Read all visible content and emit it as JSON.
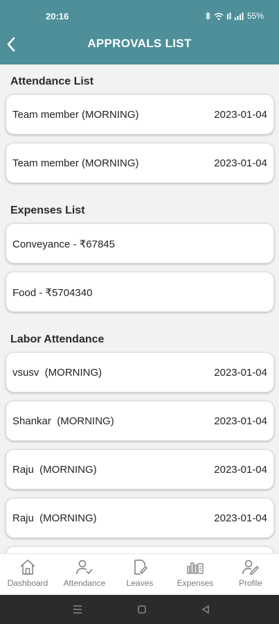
{
  "status_bar": {
    "time": "20:16",
    "battery": "55%"
  },
  "header": {
    "title": "APPROVALS LIST"
  },
  "sections": {
    "attendance": {
      "title": "Attendance List",
      "items": [
        {
          "name": "Team member (MORNING)",
          "date": "2023-01-04"
        },
        {
          "name": "Team member (MORNING)",
          "date": "2023-01-04"
        }
      ]
    },
    "expenses": {
      "title": "Expenses List",
      "items": [
        {
          "name": "Conveyance - ₹67845"
        },
        {
          "name": "Food - ₹5704340"
        }
      ]
    },
    "labor": {
      "title": "Labor Attendance",
      "items": [
        {
          "name": "vsusv  (MORNING)",
          "date": "2023-01-04"
        },
        {
          "name": "Shankar  (MORNING)",
          "date": "2023-01-04"
        },
        {
          "name": "Raju  (MORNING)",
          "date": "2023-01-04"
        },
        {
          "name": "Raju  (MORNING)",
          "date": "2023-01-04"
        }
      ]
    }
  },
  "bottom_nav": [
    {
      "label": "Dashboard",
      "icon": "house-icon"
    },
    {
      "label": "Attendance",
      "icon": "user-check-icon"
    },
    {
      "label": "Leaves",
      "icon": "document-edit-icon"
    },
    {
      "label": "Expenses",
      "icon": "bars-money-icon"
    },
    {
      "label": "Profile",
      "icon": "user-edit-icon"
    }
  ],
  "colors": {
    "primary": "#4e8f99",
    "background": "#f2f2f2",
    "card": "#ffffff"
  }
}
